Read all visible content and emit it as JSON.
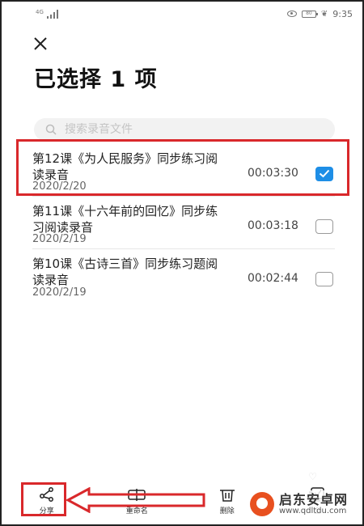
{
  "status_bar": {
    "network": "4G",
    "battery": "80",
    "time": "9:35"
  },
  "header": {
    "close_icon": "close-icon",
    "title": "已选择 1 项"
  },
  "search": {
    "placeholder": "搜索录音文件"
  },
  "recordings": [
    {
      "title": "第12课《为人民服务》同步练习阅读录音",
      "date": "2020/2/20",
      "duration": "00:03:30",
      "checked": true
    },
    {
      "title": "第11课《十六年前的回忆》同步练习阅读录音",
      "date": "2020/2/19",
      "duration": "00:03:18",
      "checked": false
    },
    {
      "title": "第10课《古诗三首》同步练习题阅读录音",
      "date": "2020/2/19",
      "duration": "00:02:44",
      "checked": false
    }
  ],
  "toolbar": {
    "share_label": "分享",
    "rename_label": "重命名",
    "delete_label": "删除",
    "select_all_label": "全"
  },
  "watermark": {
    "name": "启东安卓网",
    "url": "www.qdltdu.com"
  },
  "colors": {
    "accent": "#1e8ee6",
    "highlight": "#d9282b"
  }
}
